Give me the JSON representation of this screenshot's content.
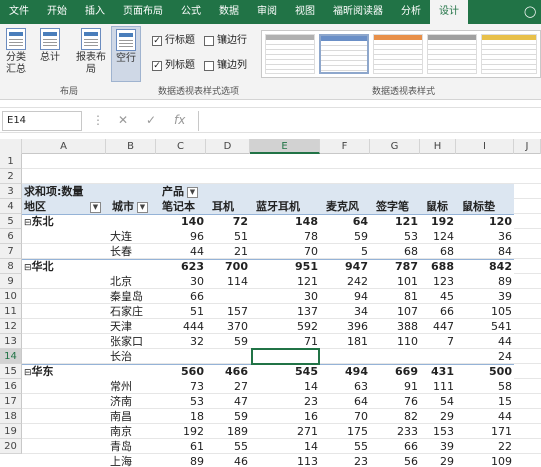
{
  "ribbon_tabs": [
    "文件",
    "开始",
    "插入",
    "页面布局",
    "公式",
    "数据",
    "审阅",
    "视图",
    "福昕阅读器",
    "分析",
    "设计"
  ],
  "active_tab": "设计",
  "buttons": {
    "subtotal": "分类汇总",
    "grandtotal": "总计",
    "report_layout": "报表布局",
    "blank_rows": "空行"
  },
  "group_layout": "布局",
  "options": {
    "row_headers": "行标题",
    "banded_rows": "镶边行",
    "col_headers": "列标题",
    "banded_cols": "镶边列"
  },
  "group_options": "数据透视表样式选项",
  "group_styles": "数据透视表样式",
  "name_box": "E14",
  "fx": "fx",
  "columns": [
    "A",
    "B",
    "C",
    "D",
    "E",
    "F",
    "G",
    "H",
    "I",
    "J"
  ],
  "active_column": "E",
  "active_row": "14",
  "rows": [
    "1",
    "2",
    "3",
    "4",
    "5",
    "6",
    "7",
    "8",
    "9",
    "10",
    "11",
    "12",
    "13",
    "14",
    "15",
    "16",
    "17",
    "18",
    "19",
    "20"
  ],
  "pivot": {
    "title": "求和项:数量",
    "col_field": "产品",
    "row_field1": "地区",
    "row_field2": "城市",
    "headers": [
      "笔记本",
      "耳机",
      "蓝牙耳机",
      "麦克风",
      "签字笔",
      "鼠标",
      "鼠标垫"
    ],
    "data": [
      {
        "label": "东北",
        "type": "region",
        "vals": [
          "140",
          "72",
          "148",
          "64",
          "121",
          "192",
          "120"
        ]
      },
      {
        "label": "大连",
        "type": "city",
        "vals": [
          "96",
          "51",
          "78",
          "59",
          "53",
          "124",
          "36"
        ]
      },
      {
        "label": "长春",
        "type": "city",
        "vals": [
          "44",
          "21",
          "70",
          "5",
          "68",
          "68",
          "84"
        ]
      },
      {
        "label": "华北",
        "type": "region",
        "vals": [
          "623",
          "700",
          "951",
          "947",
          "787",
          "688",
          "842"
        ]
      },
      {
        "label": "北京",
        "type": "city",
        "vals": [
          "30",
          "114",
          "121",
          "242",
          "101",
          "123",
          "89"
        ]
      },
      {
        "label": "秦皇岛",
        "type": "city",
        "vals": [
          "66",
          "",
          "30",
          "94",
          "81",
          "45",
          "39"
        ]
      },
      {
        "label": "石家庄",
        "type": "city",
        "vals": [
          "51",
          "157",
          "137",
          "34",
          "107",
          "66",
          "105"
        ]
      },
      {
        "label": "天津",
        "type": "city",
        "vals": [
          "444",
          "370",
          "592",
          "396",
          "388",
          "447",
          "541"
        ]
      },
      {
        "label": "张家口",
        "type": "city",
        "vals": [
          "32",
          "59",
          "71",
          "181",
          "110",
          "7",
          "44"
        ]
      },
      {
        "label": "长治",
        "type": "city",
        "vals": [
          "",
          "",
          "",
          "",
          "",
          "",
          "24"
        ]
      },
      {
        "label": "华东",
        "type": "region",
        "vals": [
          "560",
          "466",
          "545",
          "494",
          "669",
          "431",
          "500"
        ]
      },
      {
        "label": "常州",
        "type": "city",
        "vals": [
          "73",
          "27",
          "14",
          "63",
          "91",
          "111",
          "58"
        ]
      },
      {
        "label": "济南",
        "type": "city",
        "vals": [
          "53",
          "47",
          "23",
          "64",
          "76",
          "54",
          "15"
        ]
      },
      {
        "label": "南昌",
        "type": "city",
        "vals": [
          "18",
          "59",
          "16",
          "70",
          "82",
          "29",
          "44"
        ]
      },
      {
        "label": "南京",
        "type": "city",
        "vals": [
          "192",
          "189",
          "271",
          "175",
          "233",
          "153",
          "171"
        ]
      },
      {
        "label": "青岛",
        "type": "city",
        "vals": [
          "61",
          "55",
          "14",
          "55",
          "66",
          "39",
          "22"
        ]
      },
      {
        "label": "上海",
        "type": "city",
        "vals": [
          "89",
          "46",
          "113",
          "23",
          "56",
          "29",
          "109"
        ]
      }
    ]
  },
  "collapse_glyph": "⊟",
  "filter_glyph": "▼",
  "colors": {
    "accent": "#217346",
    "pivot_header": "#dce6f1",
    "pivot_line": "#95b3d7"
  }
}
